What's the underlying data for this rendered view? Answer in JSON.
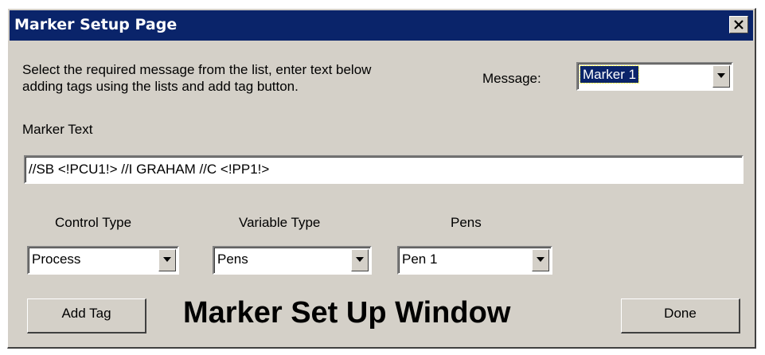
{
  "window": {
    "title": "Marker Setup Page",
    "close_icon": "close-x-icon"
  },
  "instructions": "Select the required message from the list, enter text below",
  "instructions_line2": "adding tags using the lists and add tag button.",
  "message": {
    "label": "Message:",
    "selected": "Marker 1"
  },
  "marker_text": {
    "label": "Marker Text",
    "value": "//SB <!PCU1!> //I GRAHAM //C <!PP1!>"
  },
  "control_type": {
    "label": "Control Type",
    "selected": "Process"
  },
  "variable_type": {
    "label": "Variable Type",
    "selected": "Pens"
  },
  "pens": {
    "label": "Pens",
    "selected": "Pen 1"
  },
  "buttons": {
    "add_tag": "Add Tag",
    "done": "Done"
  },
  "overlay_caption": "Marker Set Up Window",
  "colors": {
    "title_bar": "#0a246a",
    "face": "#d4d0c8",
    "selection": "#0a246a"
  }
}
